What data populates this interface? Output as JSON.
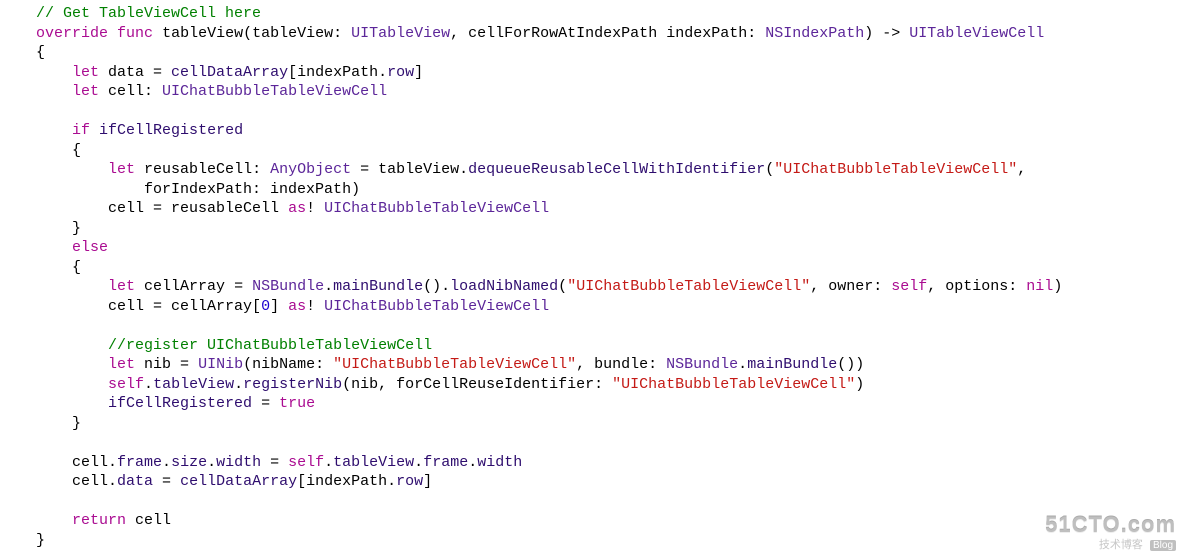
{
  "code": {
    "lines": [
      {
        "indent": 1,
        "segments": [
          {
            "cls": "tok-comment",
            "t": "// Get TableViewCell here"
          }
        ]
      },
      {
        "indent": 1,
        "segments": [
          {
            "cls": "tok-keyword",
            "t": "override"
          },
          {
            "cls": "",
            "t": " "
          },
          {
            "cls": "tok-keyword",
            "t": "func"
          },
          {
            "cls": "",
            "t": " "
          },
          {
            "cls": "tok-funcname",
            "t": "tableView"
          },
          {
            "cls": "",
            "t": "(tableView: "
          },
          {
            "cls": "tok-type",
            "t": "UITableView"
          },
          {
            "cls": "",
            "t": ", cellForRowAtIndexPath indexPath: "
          },
          {
            "cls": "tok-type",
            "t": "NSIndexPath"
          },
          {
            "cls": "",
            "t": ") -> "
          },
          {
            "cls": "tok-type",
            "t": "UITableViewCell"
          }
        ]
      },
      {
        "indent": 1,
        "segments": [
          {
            "cls": "",
            "t": "{"
          }
        ]
      },
      {
        "indent": 2,
        "segments": [
          {
            "cls": "tok-keyword",
            "t": "let"
          },
          {
            "cls": "",
            "t": " data = "
          },
          {
            "cls": "tok-member",
            "t": "cellDataArray"
          },
          {
            "cls": "",
            "t": "[indexPath."
          },
          {
            "cls": "tok-member",
            "t": "row"
          },
          {
            "cls": "",
            "t": "]"
          }
        ]
      },
      {
        "indent": 2,
        "segments": [
          {
            "cls": "tok-keyword",
            "t": "let"
          },
          {
            "cls": "",
            "t": " cell: "
          },
          {
            "cls": "tok-type",
            "t": "UIChatBubbleTableViewCell"
          }
        ]
      },
      {
        "indent": 2,
        "segments": [
          {
            "cls": "",
            "t": ""
          }
        ]
      },
      {
        "indent": 2,
        "segments": [
          {
            "cls": "tok-keyword",
            "t": "if"
          },
          {
            "cls": "",
            "t": " "
          },
          {
            "cls": "tok-member",
            "t": "ifCellRegistered"
          }
        ]
      },
      {
        "indent": 2,
        "segments": [
          {
            "cls": "",
            "t": "{"
          }
        ]
      },
      {
        "indent": 3,
        "segments": [
          {
            "cls": "tok-keyword",
            "t": "let"
          },
          {
            "cls": "",
            "t": " reusableCell: "
          },
          {
            "cls": "tok-type",
            "t": "AnyObject"
          },
          {
            "cls": "",
            "t": " = tableView."
          },
          {
            "cls": "tok-call",
            "t": "dequeueReusableCellWithIdentifier"
          },
          {
            "cls": "",
            "t": "("
          },
          {
            "cls": "tok-string",
            "t": "\"UIChatBubbleTableViewCell\""
          },
          {
            "cls": "",
            "t": ","
          }
        ]
      },
      {
        "indent": 4,
        "segments": [
          {
            "cls": "",
            "t": "forIndexPath: indexPath)"
          }
        ]
      },
      {
        "indent": 3,
        "segments": [
          {
            "cls": "",
            "t": "cell = reusableCell "
          },
          {
            "cls": "tok-keyword",
            "t": "as"
          },
          {
            "cls": "",
            "t": "! "
          },
          {
            "cls": "tok-type",
            "t": "UIChatBubbleTableViewCell"
          }
        ]
      },
      {
        "indent": 2,
        "segments": [
          {
            "cls": "",
            "t": "}"
          }
        ]
      },
      {
        "indent": 2,
        "segments": [
          {
            "cls": "tok-keyword",
            "t": "else"
          }
        ]
      },
      {
        "indent": 2,
        "segments": [
          {
            "cls": "",
            "t": "{"
          }
        ]
      },
      {
        "indent": 3,
        "segments": [
          {
            "cls": "tok-keyword",
            "t": "let"
          },
          {
            "cls": "",
            "t": " cellArray = "
          },
          {
            "cls": "tok-type",
            "t": "NSBundle"
          },
          {
            "cls": "",
            "t": "."
          },
          {
            "cls": "tok-call",
            "t": "mainBundle"
          },
          {
            "cls": "",
            "t": "()."
          },
          {
            "cls": "tok-call",
            "t": "loadNibNamed"
          },
          {
            "cls": "",
            "t": "("
          },
          {
            "cls": "tok-string",
            "t": "\"UIChatBubbleTableViewCell\""
          },
          {
            "cls": "",
            "t": ", owner: "
          },
          {
            "cls": "tok-keyword",
            "t": "self"
          },
          {
            "cls": "",
            "t": ", options: "
          },
          {
            "cls": "tok-keyword",
            "t": "nil"
          },
          {
            "cls": "",
            "t": ")"
          }
        ]
      },
      {
        "indent": 3,
        "segments": [
          {
            "cls": "",
            "t": "cell = cellArray["
          },
          {
            "cls": "tok-number",
            "t": "0"
          },
          {
            "cls": "",
            "t": "] "
          },
          {
            "cls": "tok-keyword",
            "t": "as"
          },
          {
            "cls": "",
            "t": "! "
          },
          {
            "cls": "tok-type",
            "t": "UIChatBubbleTableViewCell"
          }
        ]
      },
      {
        "indent": 3,
        "segments": [
          {
            "cls": "",
            "t": ""
          }
        ]
      },
      {
        "indent": 3,
        "segments": [
          {
            "cls": "tok-comment",
            "t": "//register UIChatBubbleTableViewCell"
          }
        ]
      },
      {
        "indent": 3,
        "segments": [
          {
            "cls": "tok-keyword",
            "t": "let"
          },
          {
            "cls": "",
            "t": " nib = "
          },
          {
            "cls": "tok-type",
            "t": "UINib"
          },
          {
            "cls": "",
            "t": "(nibName: "
          },
          {
            "cls": "tok-string",
            "t": "\"UIChatBubbleTableViewCell\""
          },
          {
            "cls": "",
            "t": ", bundle: "
          },
          {
            "cls": "tok-type",
            "t": "NSBundle"
          },
          {
            "cls": "",
            "t": "."
          },
          {
            "cls": "tok-call",
            "t": "mainBundle"
          },
          {
            "cls": "",
            "t": "())"
          }
        ]
      },
      {
        "indent": 3,
        "segments": [
          {
            "cls": "tok-keyword",
            "t": "self"
          },
          {
            "cls": "",
            "t": "."
          },
          {
            "cls": "tok-member",
            "t": "tableView"
          },
          {
            "cls": "",
            "t": "."
          },
          {
            "cls": "tok-call",
            "t": "registerNib"
          },
          {
            "cls": "",
            "t": "(nib, forCellReuseIdentifier: "
          },
          {
            "cls": "tok-string",
            "t": "\"UIChatBubbleTableViewCell\""
          },
          {
            "cls": "",
            "t": ")"
          }
        ]
      },
      {
        "indent": 3,
        "segments": [
          {
            "cls": "tok-member",
            "t": "ifCellRegistered"
          },
          {
            "cls": "",
            "t": " = "
          },
          {
            "cls": "tok-bool",
            "t": "true"
          }
        ]
      },
      {
        "indent": 2,
        "segments": [
          {
            "cls": "",
            "t": "}"
          }
        ]
      },
      {
        "indent": 2,
        "segments": [
          {
            "cls": "",
            "t": ""
          }
        ]
      },
      {
        "indent": 2,
        "segments": [
          {
            "cls": "",
            "t": "cell."
          },
          {
            "cls": "tok-member",
            "t": "frame"
          },
          {
            "cls": "",
            "t": "."
          },
          {
            "cls": "tok-member",
            "t": "size"
          },
          {
            "cls": "",
            "t": "."
          },
          {
            "cls": "tok-member",
            "t": "width"
          },
          {
            "cls": "",
            "t": " = "
          },
          {
            "cls": "tok-keyword",
            "t": "self"
          },
          {
            "cls": "",
            "t": "."
          },
          {
            "cls": "tok-member",
            "t": "tableView"
          },
          {
            "cls": "",
            "t": "."
          },
          {
            "cls": "tok-member",
            "t": "frame"
          },
          {
            "cls": "",
            "t": "."
          },
          {
            "cls": "tok-member",
            "t": "width"
          }
        ]
      },
      {
        "indent": 2,
        "segments": [
          {
            "cls": "",
            "t": "cell."
          },
          {
            "cls": "tok-member",
            "t": "data"
          },
          {
            "cls": "",
            "t": " = "
          },
          {
            "cls": "tok-member",
            "t": "cellDataArray"
          },
          {
            "cls": "",
            "t": "[indexPath."
          },
          {
            "cls": "tok-member",
            "t": "row"
          },
          {
            "cls": "",
            "t": "]"
          }
        ]
      },
      {
        "indent": 2,
        "segments": [
          {
            "cls": "",
            "t": ""
          }
        ]
      },
      {
        "indent": 2,
        "segments": [
          {
            "cls": "tok-keyword",
            "t": "return"
          },
          {
            "cls": "",
            "t": " cell"
          }
        ]
      },
      {
        "indent": 1,
        "segments": [
          {
            "cls": "",
            "t": "}"
          }
        ]
      }
    ],
    "indent_unit": "    "
  },
  "watermark": {
    "main": "51CTO.com",
    "sub": "技术博客",
    "blog": "Blog"
  }
}
